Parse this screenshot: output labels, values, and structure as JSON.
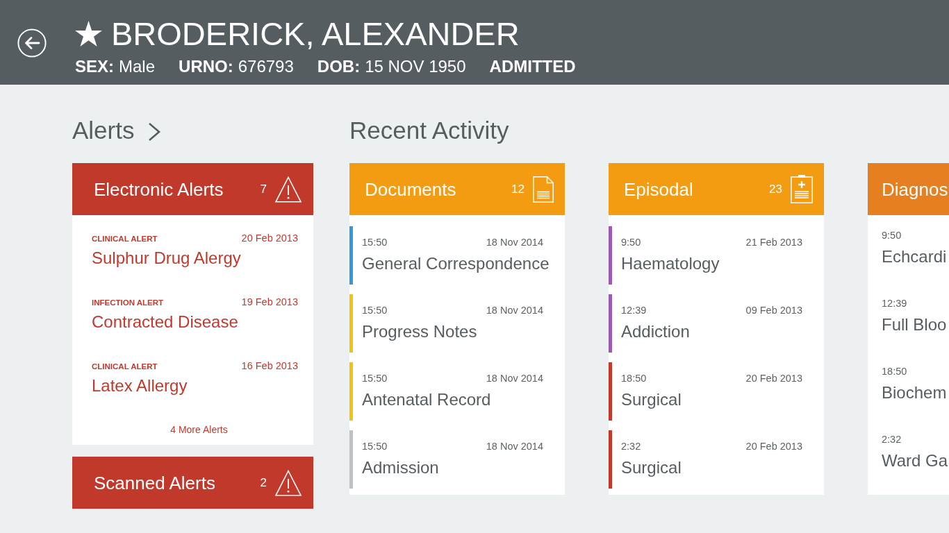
{
  "patient": {
    "starred": true,
    "name": "BRODERICK, ALEXANDER",
    "details": [
      {
        "label": "SEX:",
        "value": "Male"
      },
      {
        "label": "URNO:",
        "value": "676793"
      },
      {
        "label": "DOB:",
        "value": "15 NOV 1950"
      }
    ],
    "status": "ADMITTED"
  },
  "alerts": {
    "heading": "Alerts",
    "groups": [
      {
        "title": "Electronic Alerts",
        "count": "7",
        "items": [
          {
            "type": "CLINICAL ALERT",
            "date": "20 Feb 2013",
            "title": "Sulphur Drug Alergy"
          },
          {
            "type": "INFECTION ALERT",
            "date": "19 Feb 2013",
            "title": "Contracted Disease"
          },
          {
            "type": "CLINICAL ALERT",
            "date": "16 Feb 2013",
            "title": "Latex Allergy"
          }
        ],
        "more": "4 More Alerts"
      },
      {
        "title": "Scanned Alerts",
        "count": "2"
      }
    ]
  },
  "activity": {
    "heading": "Recent Activity",
    "cards": [
      {
        "title": "Documents",
        "kind": "document",
        "count": "12",
        "color": "#f39c12",
        "items": [
          {
            "time": "15:50",
            "date": "18 Nov 2014",
            "title": "General Correspondence",
            "color": "#3498db"
          },
          {
            "time": "15:50",
            "date": "18 Nov 2014",
            "title": "Progress Notes",
            "color": "#f1c40f"
          },
          {
            "time": "15:50",
            "date": "18 Nov 2014",
            "title": "Antenatal Record",
            "color": "#f1c40f"
          },
          {
            "time": "15:50",
            "date": "18 Nov 2014",
            "title": "Admission",
            "color": "#bdc3c7"
          }
        ]
      },
      {
        "title": "Episodal",
        "kind": "clipboard",
        "count": "23",
        "color": "#f39c12",
        "items": [
          {
            "time": "9:50",
            "date": "21 Feb 2013",
            "title": "Haematology",
            "color": "#9b59b6"
          },
          {
            "time": "12:39",
            "date": "09 Feb 2013",
            "title": "Addiction",
            "color": "#9b59b6"
          },
          {
            "time": "18:50",
            "date": "20 Feb 2013",
            "title": "Surgical",
            "color": "#c0392b"
          },
          {
            "time": "2:32",
            "date": "20 Feb 2013",
            "title": "Surgical",
            "color": "#c0392b"
          }
        ]
      },
      {
        "title": "Diagnos",
        "color": "#e67e22",
        "items": [
          {
            "time": "9:50",
            "title": "Echcardi"
          },
          {
            "time": "12:39",
            "title": "Full Bloo"
          },
          {
            "time": "18:50",
            "title": "Biochem"
          },
          {
            "time": "2:32",
            "title": "Ward Ga"
          }
        ]
      }
    ]
  }
}
